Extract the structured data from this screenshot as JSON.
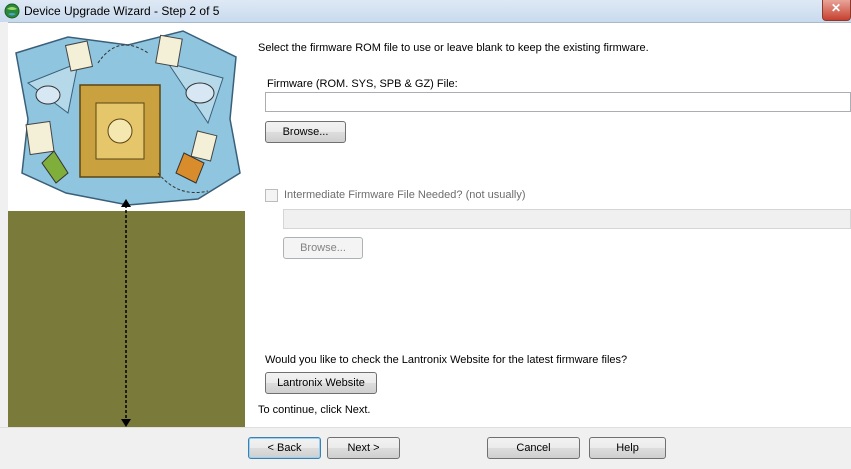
{
  "window": {
    "title": "Device Upgrade Wizard - Step 2 of 5",
    "close_glyph": "✕",
    "icon": "globe-app-icon"
  },
  "content": {
    "instruction": "Select the firmware ROM file to use or leave blank to keep the existing firmware.",
    "firmware_label": "Firmware (ROM. SYS, SPB & GZ) File:",
    "firmware_value": "",
    "browse_label": "Browse...",
    "intermediate_checkbox_label": "Intermediate Firmware File Needed? (not usually)",
    "intermediate_checked": false,
    "intermediate_value": "",
    "intermediate_browse_label": "Browse...",
    "website_question": "Would you like to check the Lantronix Website for the latest firmware files?",
    "website_button_label": "Lantronix Website",
    "continue_text": "To continue, click Next."
  },
  "footer": {
    "back_label": "< Back",
    "next_label": "Next >",
    "cancel_label": "Cancel",
    "help_label": "Help"
  },
  "colors": {
    "side_panel": "#7a7a3a",
    "title_bar": "#c9daee",
    "close_button": "#c7402e"
  }
}
